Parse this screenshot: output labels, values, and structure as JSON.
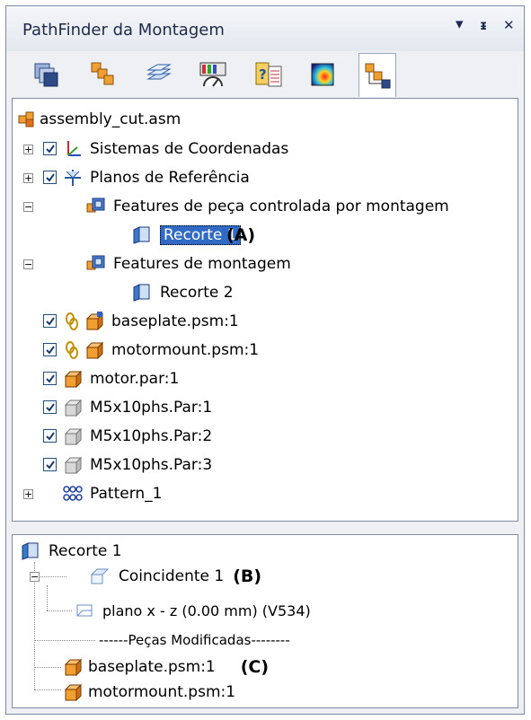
{
  "window": {
    "title": "PathFinder da Montagem",
    "controls": {
      "menu": "▾",
      "pin": "ᵻ",
      "close": "✕"
    }
  },
  "tabs": [
    {
      "icon": "parts-library-icon"
    },
    {
      "icon": "assembly-parts-icon"
    },
    {
      "icon": "layers-icon"
    },
    {
      "icon": "sensors-icon"
    },
    {
      "icon": "help-doc-icon"
    },
    {
      "icon": "render-icon"
    },
    {
      "icon": "pathfinder-icon",
      "active": true
    }
  ],
  "tree": {
    "root": "assembly_cut.asm",
    "items": [
      {
        "label": "Sistemas de Coordenadas",
        "icon": "coordinate-system-icon"
      },
      {
        "label": "Planos de Referência",
        "icon": "reference-planes-icon"
      },
      {
        "label": "Features de peça controlada por montagem",
        "icon": "assembly-feature-icon"
      },
      {
        "label": "Recorte 1",
        "icon": "cut-feature-icon",
        "annotation": "(A)"
      },
      {
        "label": "Features de montagem",
        "icon": "assembly-feature-icon"
      },
      {
        "label": "Recorte 2",
        "icon": "cut-feature-icon"
      },
      {
        "label": "baseplate.psm:1",
        "icon": "sheetmetal-part-icon"
      },
      {
        "label": "motormount.psm:1",
        "icon": "sheetmetal-part-icon"
      },
      {
        "label": "motor.par:1",
        "icon": "part-icon"
      },
      {
        "label": "M5x10phs.Par:1",
        "icon": "fastener-part-icon"
      },
      {
        "label": "M5x10phs.Par:2",
        "icon": "fastener-part-icon"
      },
      {
        "label": "M5x10phs.Par:3",
        "icon": "fastener-part-icon"
      },
      {
        "label": "Pattern_1",
        "icon": "pattern-icon"
      }
    ]
  },
  "lower": {
    "root": "Recorte 1",
    "relation": "Coincidente 1",
    "relation_annotation": "(B)",
    "plane_label": "plano x - z  (0.00 mm)  (V534)",
    "modified_header": "------Peças Modificadas--------",
    "modified_parts": [
      "baseplate.psm:1",
      "motormount.psm:1"
    ],
    "parts_annotation": "(C)"
  },
  "colors": {
    "selection": "#316ac5",
    "part_orange": "#e8901c",
    "feature_blue": "#2a6fc0"
  }
}
